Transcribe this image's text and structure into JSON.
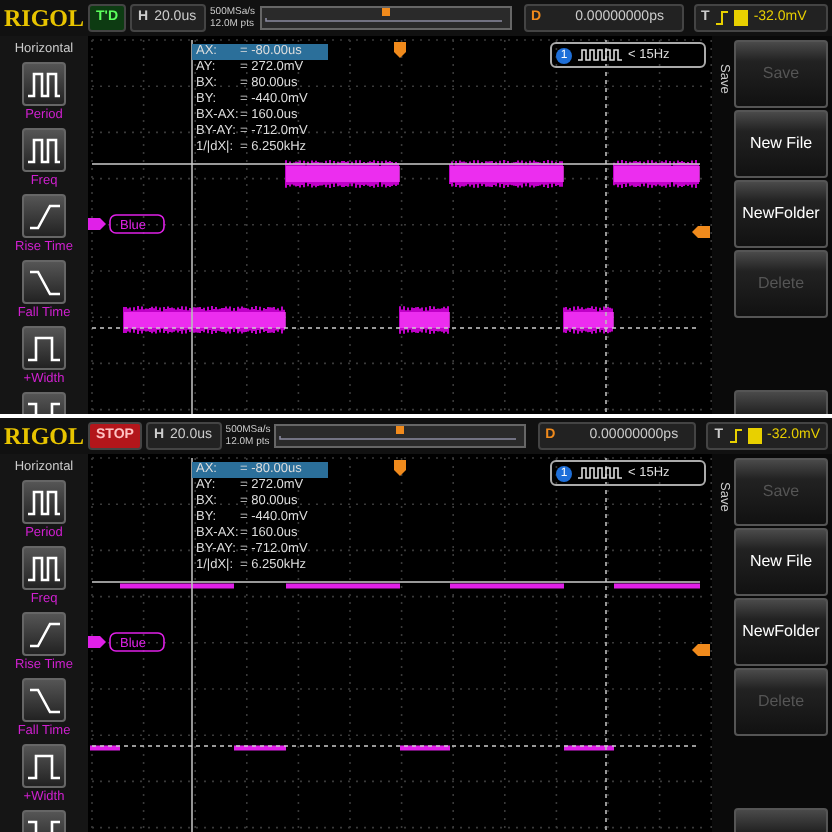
{
  "screens": [
    {
      "header": {
        "logo": "RIGOL",
        "run_state": {
          "label": "T'D",
          "kind": "triggered"
        },
        "timebase_label": "H",
        "timebase": "20.0us",
        "sample_rate": "500MSa/s",
        "memory_depth": "12.0M pts",
        "delay_label": "D",
        "delay": "0.00000000ps",
        "trigger_label": "T",
        "trigger_level": "-32.0mV"
      },
      "measure_menu": {
        "title": "Horizontal",
        "items": [
          {
            "label": "Period",
            "kind": "period"
          },
          {
            "label": "Freq",
            "kind": "freq"
          },
          {
            "label": "Rise Time",
            "kind": "rise"
          },
          {
            "label": "Fall Time",
            "kind": "fall"
          },
          {
            "label": "+Width",
            "kind": "pwidth"
          },
          {
            "kind": "nwidth"
          }
        ]
      },
      "cursor_readout": [
        {
          "name": "AX:",
          "value": "= -80.00us",
          "selected": true
        },
        {
          "name": "AY:",
          "value": "= 272.0mV",
          "selected": false
        },
        {
          "name": "BX:",
          "value": "= 80.00us",
          "selected": false
        },
        {
          "name": "BY:",
          "value": "= -440.0mV",
          "selected": false
        },
        {
          "name": "BX-AX:",
          "value": "= 160.0us",
          "selected": false
        },
        {
          "name": "BY-AY:",
          "value": "= -712.0mV",
          "selected": false
        },
        {
          "name": "1/|dX|:",
          "value": "= 6.250kHz",
          "selected": false
        }
      ],
      "counter": {
        "badge": "1",
        "reading": "< 15Hz"
      },
      "channel_label": "Blue",
      "trace": {
        "kind": "noisy"
      },
      "softkeys": {
        "menu_title": "Save",
        "buttons": [
          {
            "label": "Save",
            "disabled": true
          },
          {
            "label": "New File",
            "disabled": false
          },
          {
            "label": "NewFolder",
            "disabled": false
          },
          {
            "label": "Delete",
            "disabled": true
          }
        ]
      }
    },
    {
      "header": {
        "logo": "RIGOL",
        "run_state": {
          "label": "STOP",
          "kind": "stopped"
        },
        "timebase_label": "H",
        "timebase": "20.0us",
        "sample_rate": "500MSa/s",
        "memory_depth": "12.0M pts",
        "delay_label": "D",
        "delay": "0.00000000ps",
        "trigger_label": "T",
        "trigger_level": "-32.0mV"
      },
      "measure_menu": {
        "title": "Horizontal",
        "items": [
          {
            "label": "Period",
            "kind": "period"
          },
          {
            "label": "Freq",
            "kind": "freq"
          },
          {
            "label": "Rise Time",
            "kind": "rise"
          },
          {
            "label": "Fall Time",
            "kind": "fall"
          },
          {
            "label": "+Width",
            "kind": "pwidth"
          },
          {
            "kind": "nwidth"
          }
        ]
      },
      "cursor_readout": [
        {
          "name": "AX:",
          "value": "= -80.00us",
          "selected": true
        },
        {
          "name": "AY:",
          "value": "= 272.0mV",
          "selected": false
        },
        {
          "name": "BX:",
          "value": "= 80.00us",
          "selected": false
        },
        {
          "name": "BY:",
          "value": "= -440.0mV",
          "selected": false
        },
        {
          "name": "BX-AX:",
          "value": "= 160.0us",
          "selected": false
        },
        {
          "name": "BY-AY:",
          "value": "= -712.0mV",
          "selected": false
        },
        {
          "name": "1/|dX|:",
          "value": "= 6.250kHz",
          "selected": false
        }
      ],
      "counter": {
        "badge": "1",
        "reading": "< 15Hz"
      },
      "channel_label": "Blue",
      "trace": {
        "kind": "clean"
      },
      "softkeys": {
        "menu_title": "Save",
        "buttons": [
          {
            "label": "Save",
            "disabled": true
          },
          {
            "label": "New File",
            "disabled": false
          },
          {
            "label": "NewFolder",
            "disabled": false
          },
          {
            "label": "Delete",
            "disabled": true
          }
        ]
      }
    }
  ]
}
